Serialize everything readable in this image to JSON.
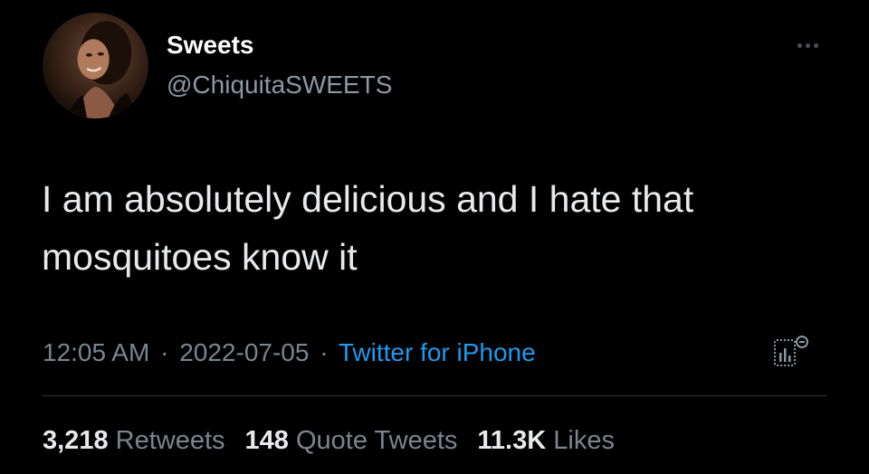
{
  "user": {
    "display_name": "Sweets",
    "handle": "@ChiquitaSWEETS"
  },
  "tweet": {
    "text": "I am absolutely delicious and I hate that mosquitoes know it"
  },
  "meta": {
    "time": "12:05 AM",
    "date": "2022-07-05",
    "separator": "·",
    "source": "Twitter for iPhone"
  },
  "stats": {
    "retweets_count": "3,218",
    "retweets_label": "Retweets",
    "quotes_count": "148",
    "quotes_label": "Quote Tweets",
    "likes_count": "11.3K",
    "likes_label": "Likes"
  },
  "colors": {
    "background": "#000000",
    "text": "#e7e9ea",
    "secondary": "#7a8590",
    "link": "#1d9bf0",
    "divider": "#2f3336"
  },
  "icons": {
    "more": "more-dots-icon",
    "analytics": "analytics-icon"
  }
}
